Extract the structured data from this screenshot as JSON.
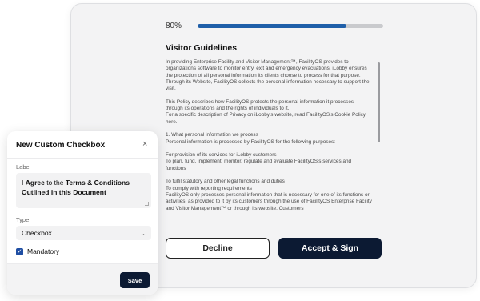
{
  "progress": {
    "label": "80%",
    "value": 0.8,
    "color": "#1f5fa9"
  },
  "document": {
    "title": "Visitor Guidelines",
    "paragraphs": [
      "In providing Enterprise Facility and Visitor Management™, FacilityOS provides to organizations software to monitor entry, exit and emergency evacuations. iLobby ensures the protection of all personal information its clients choose to process for that purpose. Through its Website, FacilityOS collects the personal information necessary to support the visit.",
      "This Policy describes how FacilityOS protects the personal information it processes through its operations and the rights of individuals to it.\nFor a specific description of Privacy on iLobby's website, read FacilityOS's Cookie Policy, here.",
      "1. What personal information we process\nPersonal information is processed by FacilityOS for the following purposes:",
      "For provision of its services for iLobby customers\nTo plan, fund, implement, monitor, regulate and evaluate FacilityOS's services and functions",
      "To fulfil statutory and other legal functions and duties\nTo comply with reporting requirements\nFacilityOS only processes personal information that is necessary for one of its functions or activities, as provided to it by its customers through the use of FacilityOS Enterprise Facility and Visitor Management™ or through its website. Customers"
    ]
  },
  "buttons": {
    "decline": "Decline",
    "accept": "Accept & Sign"
  },
  "dialog": {
    "title": "New Custom Checkbox",
    "close_icon": "×",
    "label_caption": "Label",
    "label_value_pre": "I ",
    "label_value_bold1": "Agree",
    "label_value_mid": " to the ",
    "label_value_bold2": "Terms & Conditions Outlined in this Document",
    "type_caption": "Type",
    "type_value": "Checkbox",
    "chevron_icon": "⌄",
    "mandatory_label": "Mandatory",
    "mandatory_checked": true,
    "save_label": "Save"
  }
}
